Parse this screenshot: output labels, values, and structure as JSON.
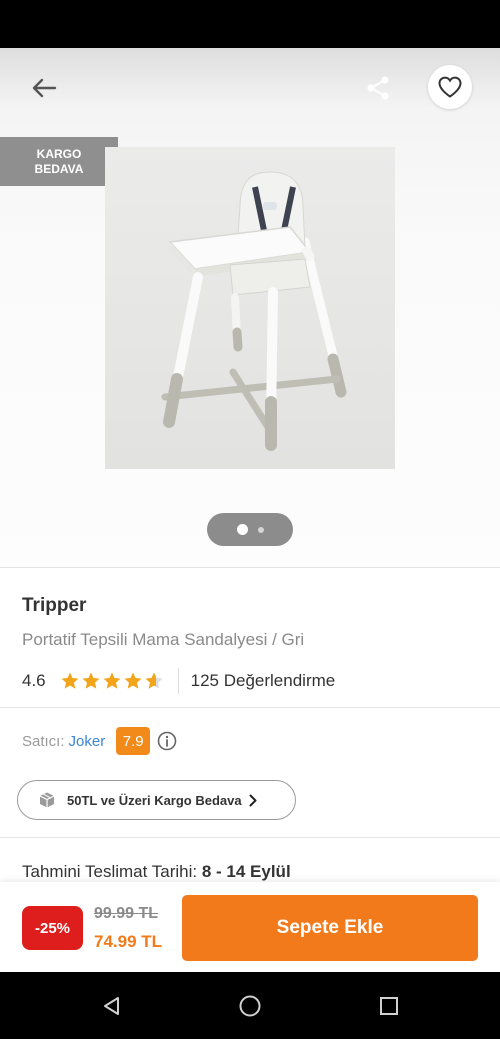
{
  "header": {
    "back_icon": "arrow-left-icon",
    "share_icon": "share-icon",
    "favorite_icon": "heart-icon"
  },
  "badge": {
    "line1": "KARGO",
    "line2": "BEDAVA"
  },
  "gallery": {
    "image_subject": "white and grey high chair with tray",
    "current_page": 1,
    "page_count": 2
  },
  "product": {
    "brand": "Tripper",
    "name": "Portatif Tepsili Mama Sandalyesi / Gri",
    "rating": "4.6",
    "stars": 4.6,
    "review_count": "125 Değerlendirme"
  },
  "seller": {
    "label": "Satıcı:",
    "name": "Joker",
    "score": "7.9"
  },
  "shipping": {
    "label": "50TL ve Üzeri Kargo Bedava",
    "icon": "package-box-icon"
  },
  "delivery": {
    "label": "Tahmini Teslimat Tarihi:",
    "value": "8 - 14 Eylül"
  },
  "purchase": {
    "discount": "-25%",
    "old_price": "99.99 TL",
    "new_price": "74.99 TL",
    "button_label": "Sepete Ekle"
  },
  "colors": {
    "accent": "#f27a1a",
    "discount_red": "#de1d1d",
    "link_blue": "#3d86d6",
    "badge_grey": "#8f8f8f"
  },
  "system_nav": {
    "back": "triangle-back-icon",
    "home": "circle-home-icon",
    "recents": "square-recents-icon"
  }
}
